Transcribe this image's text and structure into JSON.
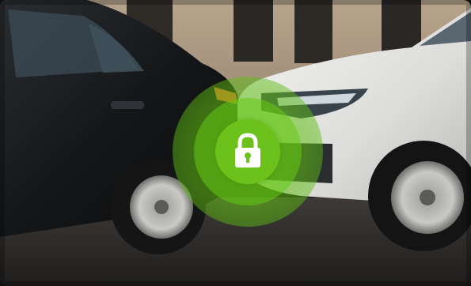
{
  "scene": {
    "description_icon": "padlock-icon",
    "colors": {
      "lock_green": "#6cc21a",
      "lock_glow": "#78d21e"
    }
  }
}
